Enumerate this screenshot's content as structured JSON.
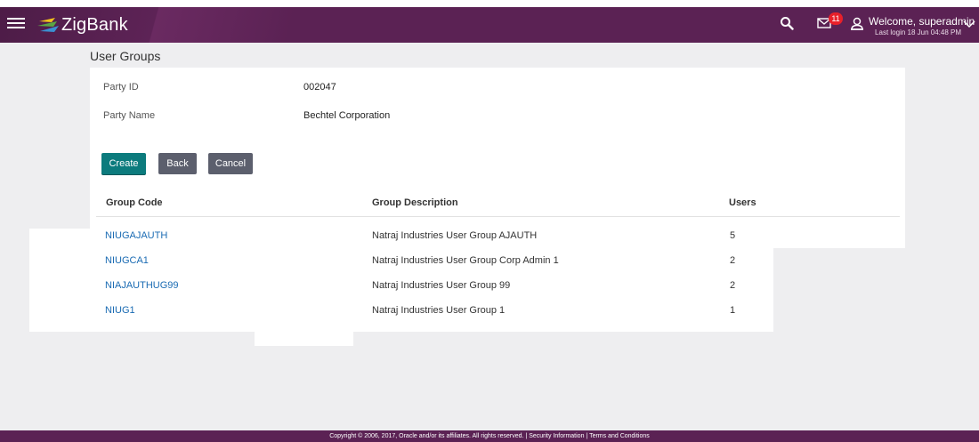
{
  "header": {
    "brand": "ZigBank",
    "notification_count": "11",
    "welcome_text": "Welcome, superadmin",
    "last_login": "Last login 18 Jun 04:48 PM",
    "icons": [
      "menu-icon",
      "logo-icon",
      "search-icon",
      "mail-icon",
      "user-icon",
      "chevron-down-icon"
    ],
    "colors": {
      "header_bg": "#5b2254",
      "primary_button": "#0c7b7d",
      "secondary_button": "#5c5f6d",
      "link": "#1a6bb3",
      "badge": "#e8202a"
    }
  },
  "page": {
    "title": "User Groups",
    "party_id_label": "Party ID",
    "party_id_value": "002047",
    "party_name_label": "Party Name",
    "party_name_value": "Bechtel Corporation"
  },
  "actions": {
    "create": "Create",
    "back": "Back",
    "cancel": "Cancel"
  },
  "table": {
    "headers": {
      "code": "Group Code",
      "description": "Group Description",
      "users": "Users"
    },
    "rows": [
      {
        "code": "NIUGAJAUTH",
        "description": "Natraj Industries User Group AJAUTH",
        "users": "5"
      },
      {
        "code": "NIUGCA1",
        "description": "Natraj Industries User Group Corp Admin 1",
        "users": "2"
      },
      {
        "code": "NIAJAUTHUG99",
        "description": "Natraj Industries User Group 99",
        "users": "2"
      },
      {
        "code": "NIUG1",
        "description": "Natraj Industries User Group 1",
        "users": "1"
      }
    ]
  },
  "footer": {
    "copyright": "Copyright © 2006, 2017, Oracle and/or its affiliates. All rights reserved.",
    "separator": "|",
    "security_link": "Security Information",
    "terms_link": "Terms and Conditions"
  }
}
